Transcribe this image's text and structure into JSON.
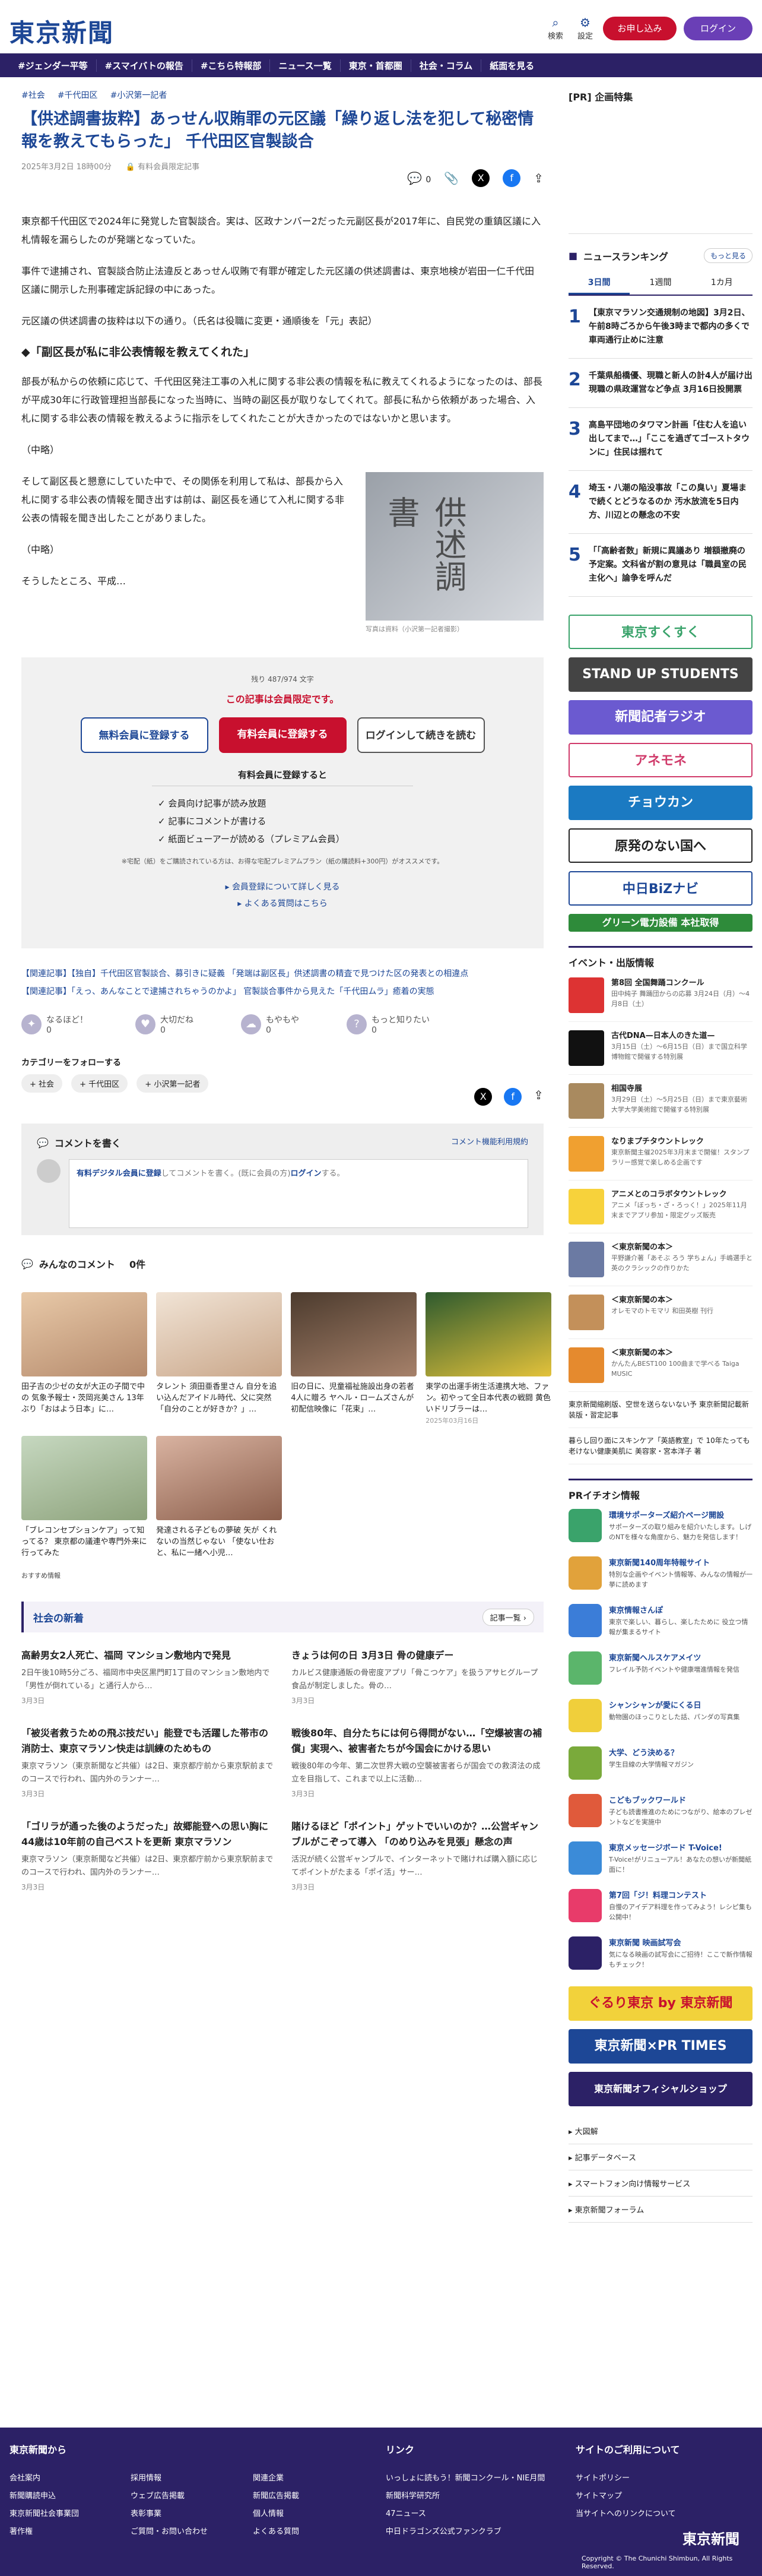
{
  "header": {
    "logo": "東京新聞",
    "search": "検索",
    "settings": "設定",
    "free": "お申し込み",
    "login": "ログイン"
  },
  "nav": [
    "#ジェンダー平等",
    "#スマイバトの報告",
    "#こちら特報部",
    "ニュース一覧",
    "東京・首都圏",
    "社会・コラム",
    "紙面を見る"
  ],
  "breadcrumb": [
    "#社会",
    "#千代田区",
    "#小沢第一記者"
  ],
  "article": {
    "title": "【供述調書抜粋】あっせん収賄罪の元区議「繰り返し法を犯して秘密情報を教えてもらった」 千代田区官製談合",
    "date": "2025年3月2日 18時00分",
    "member": "有料会員限定記事",
    "comments": "0",
    "p1": "東京都千代田区で2024年に発覚した官製談合。実は、区政ナンバー2だった元副区長が2017年に、自民党の重鎮区議に入札情報を漏らしたのが発端となっていた。",
    "p2": "事件で逮捕され、官製談合防止法違反とあっせん収賄で有罪が確定した元区議の供述調書は、東京地検が岩田一仁千代田区議に開示した刑事確定訴記録の中にあった。",
    "p3": "元区議の供述調書の抜粋は以下の通り。（氏名は役職に変更・通順後を「元」表記）",
    "h2": "◆「副区長が私に非公表情報を教えてくれた」",
    "p4": "部長が私からの依頼に応じて、千代田区発注工事の入札に関する非公表の情報を私に教えてくれるようになったのは、部長が平成30年に行政管理担当部長になった当時に、当時の副区長が取りなしてくれて。部長に私から依頼があった場合、入札に関する非公表の情報を教えるように指示をしてくれたことが大きかったのではないかと思います。",
    "p5": "（中略）",
    "p6": "そして副区長と懇意にしていた中で、その関係を利用して私は、部長から入札に関する非公表の情報を聞き出すは前は、副区長を通じて入札に関する非公表の情報を聞き出したことがありました。",
    "p7": "（中略）",
    "p8": "そうしたところ、平成…",
    "img_title": "供述調書",
    "caption": "写真は資料（小沢第一記者撮影）"
  },
  "paywall": {
    "count": "残り 487/974 文字",
    "msg": "この記事は会員限定です。",
    "free_btn": "無料会員に登録する",
    "paid_btn": "有料会員に登録する",
    "login_btn": "ログインして続きを読む",
    "benefit_title": "有料会員に登録すると",
    "benefits": [
      "会員向け記事が読み放題",
      "記事にコメントが書ける",
      "紙面ビューアーが読める（プレミアム会員）"
    ],
    "note": "※宅配（紙）をご購読されている方は、お得な宅配プレミアムプラン（紙の購読料+300円）がオススメです。",
    "link1": "会員登録について詳しく見る",
    "link2": "よくある質問はこちら"
  },
  "related": [
    "【関連記事】【独自】千代田区官製談合、募引きに疑義 「発端は副区長」供述調書の精査で見つけた区の発表との相違点",
    "【関連記事】「えっ、あんなことで逮捕されちゃうのかよ」 官製談合事件から見えた「千代田ムラ」癒着の実態"
  ],
  "reactions": [
    "なるほど！",
    "大切だね",
    "もやもや",
    "もっと知りたい"
  ],
  "reaction_counts": [
    "0",
    "0",
    "0",
    "0"
  ],
  "follow": {
    "title": "カテゴリーをフォローする",
    "tags": [
      "社会",
      "千代田区",
      "小沢第一記者"
    ]
  },
  "comment": {
    "title": "コメントを書く",
    "policy": "コメント機能利用規約",
    "placeholder_link": "有料デジタル会員に登録",
    "placeholder_text": "してコメントを書く。(既に会員の方)",
    "login": "ログイン",
    "tail": "する。"
  },
  "allcomments": {
    "title": "みんなのコメント",
    "count": "0件"
  },
  "thumbs": [
    {
      "t": "田子吉の少ゼの女が大正の子間で中の 気象予報士・茨岡兆美さん 13年ぶり「おはよう日本」に…"
    },
    {
      "t": "タレント 須田亜香里さん 自分を追い込んだアイドル時代、父に突然「自分のことが好きか？」…"
    },
    {
      "t": "旧の日に、児童福祉施設出身の若者4人に贈ろ ヤヘル・ロームズさんが初配信映像に「花束」…"
    },
    {
      "t": "東学の出運手術生活連携大地、ファン。初やって全日本代表の戦闘 黄色いドリブラーは…"
    },
    {
      "t": "「ブレコンセプションケア」って知ってる？ 東京都の議連や専門外来に行ってみた"
    },
    {
      "t": "発達される子どもの夢破 矢が くれないの当然じゃない 「使ない仕おと、私に一緒へ小児…"
    }
  ],
  "thumb_date": "2025年03月16日",
  "recommend": "おすすめ情報",
  "society": {
    "title": "社会の新着",
    "more": "記事一覧",
    "items": [
      {
        "t": "高齢男女2人死亡、福岡 マンション敷地内で発見",
        "d": "2日午後10時5分ごろ、福岡市中央区黒門町1丁目のマンション敷地内で「男性が倒れている」と通行人から…",
        "dt": "3月3日"
      },
      {
        "t": "きょうは何の日 3月3日 骨の健康デー",
        "d": "カルビス健康通販の骨密度アプリ「骨こつケア」を扱うアサヒグループ食品が制定しました。骨の…",
        "dt": "3月3日"
      },
      {
        "t": "「被災者救うための飛ぶ技だい」能登でも活躍した帯市の消防士、東京マラソン快走は訓練のためもの",
        "d": "東京マラソン（東京新聞など共催）は2日、東京都庁前から東京駅前までのコースで行われ、国内外のランナー…",
        "dt": "3月3日"
      },
      {
        "t": "戦後80年、自分たちには何ら得問がない…「空爆被害の補償」実現へ、被害者たちが今国会にかける思い",
        "d": "戦後80年の今年、第二次世界大戦の空襲被害者らが国会での救済法の成立を目指して、これまで以上に活動…",
        "dt": "3月3日"
      },
      {
        "t": "「ゴリラが通った後のようだった」故郷能登への思い胸に 44歳は10年前の自己ベストを更新 東京マラソン",
        "d": "東京マラソン（東京新聞など共催）は2日、東京都庁前から東京駅前までのコースで行われ、国内外のランナー…",
        "dt": "3月3日"
      },
      {
        "t": "賭けるほど「ポイント」ゲットでいいのか？…公営ギャンブルがこぞって導入 「のめり込みを見張」懸念の声",
        "d": "活況が続く公営ギャンブルで、インターネットで賭ければ購入額に応じてポイントがたまる「ポイ活」サー…",
        "dt": "3月3日"
      }
    ]
  },
  "sidebar": {
    "pr": "[PR] 企画特集",
    "ranking_title": "ニュースランキング",
    "ranking_more": "もっと見る",
    "tabs": [
      "3日間",
      "1週間",
      "1カ月"
    ],
    "ranking": [
      {
        "n": "1",
        "t": "【東京マラソン交通規制の地図】3月2日、午前8時ごろから午後3時まで都内の多くで車両通行止めに注意"
      },
      {
        "n": "2",
        "t": "千葉県船橋優、現職と新人の計4人が届け出 現職の県政運営など争点 3月16日投開票"
      },
      {
        "n": "3",
        "t": "高島平団地のタワマン計画「住む人を追い出してまで…」「ここを過ぎてゴーストタウンに」住民は揺れて"
      },
      {
        "n": "4",
        "t": "埼玉・八潮の陥没事故「この臭い」夏場まで続くとどうなるのか 汚水放流を5日内方、川辺との懸念の不安"
      },
      {
        "n": "5",
        "t": "「「高齢者数」新規に異議あり 増額撤廃の予定案。文科省が割の意見は「職員室の民主化へ」論争を呼んだ"
      }
    ],
    "banners": [
      {
        "t": "東京すくすく",
        "c": "#3aa36b"
      },
      {
        "t": "STAND UP STUDENTS",
        "c": "#444"
      },
      {
        "t": "新聞記者ラジオ",
        "c": "#6b5ad0"
      },
      {
        "t": "アネモネ",
        "c": "#d03a6a"
      },
      {
        "t": "チョウカン",
        "c": "#1b7ac2"
      },
      {
        "t": "原発のない国へ",
        "c": "#222"
      },
      {
        "t": "中日BiZナビ",
        "c": "#1d4796"
      },
      {
        "t": "グリーン電力設備 本社取得",
        "c": "#2e8b3a"
      }
    ],
    "event_title": "イベント・出版情報",
    "events": [
      {
        "t": "第8回 全国舞踊コンクール",
        "d": "田中純子 舞踊団からの応募 3月24日（月）〜4月8日（土）"
      },
      {
        "t": "古代DNA—日本人のきた道—",
        "d": "3月15日（土）〜6月15日（日）まで国立科学博物館で開催する特別展"
      },
      {
        "t": "相国寺展",
        "d": "3月29日（土）〜5月25日（日）まで東京藝術大学大学美術館で開催する特別展"
      },
      {
        "t": "なりまプチタウントレック",
        "d": "東京新聞主催2025年3月末まで開催！スタンプラリー感覚で楽しめる企画です"
      },
      {
        "t": "アニメとのコラボタウントレック",
        "d": "アニメ「ぼっち・ざ・ろっく！」2025年11月末までアプリ参加・限定グッズ販売"
      },
      {
        "t": "＜東京新聞の本＞",
        "d": "平野謙介著「あそぶ ろう 学ちょん」手嶋選手と英のクラシックの作りかた"
      },
      {
        "t": "＜東京新聞の本＞",
        "d": "オレモマのトモマリ 和田英樹 刊行"
      },
      {
        "t": "＜東京新聞の本＞",
        "d": "かんたんBEST100 100曲まで学べる Taiga MUSIC"
      }
    ],
    "side_links": [
      "東京新聞縮刷版、空世を送らないない予 東京新聞記載新装版・習定記事",
      "暮らし回り面にスキンケア「英語教室」で 10年たっても老けない健康美肌に 美容家・宮本洋子 著"
    ],
    "pr_title": "PRイチオシ情報",
    "pr_items": [
      {
        "t": "環境サポーターズ紹介ページ開設",
        "d": "サポーターズの取り組みを紹介いたします。しげのNTを様々な角度から、魅力を発信します！"
      },
      {
        "t": "東京新聞140周年特報サイト",
        "d": "特別な企画やイベント情報等、みんなの情報が一挙に読めます"
      },
      {
        "t": "東京情報さんぽ",
        "d": "東京で楽しい、暮らし、楽したために 役立つ情報が集まるサイト"
      },
      {
        "t": "東京新聞ヘルスケアメイツ",
        "d": "フレイル予防イベントや健康増進情報を発信"
      },
      {
        "t": "シャンシャンが愛にくる日",
        "d": "動物園のほっこりとした話、パンダの写真集"
      },
      {
        "t": "大学、どう決める？",
        "d": "学生目線の大学情報マガジン"
      },
      {
        "t": "こどもブックワールド",
        "d": "子ども読書推進のためにつながり、絵本のプレゼントなどを実施中"
      },
      {
        "t": "東京メッセージボード T-Voice!",
        "d": "T-Voice!がリニューアル！あなたの想いが新聞紙面に！"
      },
      {
        "t": "第7回「ジ！料理コンテスト",
        "d": "自慢のアイデア料理を作ってみよう！レシピ集も公開中！"
      },
      {
        "t": "東京新聞 映画試写会",
        "d": "気になる映画の試写会にご招待！ここで新作情報もチェック！"
      }
    ],
    "bottom_banners": [
      "ぐるり東京 by 東京新聞",
      "東京新聞×PR TIMES",
      "東京新聞オフィシャルショップ"
    ],
    "links": [
      "大図解",
      "記事データベース",
      "スマートフォン向け情報サービス",
      "東京新聞フォーラム"
    ]
  },
  "footer": {
    "col1": "東京新聞から",
    "col2": "リンク",
    "col3": "サイトのご利用について",
    "items1": [
      "会社案内",
      "採用情報",
      "関連企業",
      "新聞購読申込",
      "ウェブ広告掲載",
      "新聞広告掲載",
      "東京新聞社会事業団",
      "表彰事業",
      "個人情報",
      "著作権",
      "ご質問・お問い合わせ",
      "よくある質問"
    ],
    "items2": [
      "いっしょに読もう！新聞コンクール・NIE月間",
      "新聞科学研究所",
      "47ニュース",
      "中日ドラゴンズ公式ファンクラブ"
    ],
    "items3": [
      "サイトポリシー",
      "サイトマップ",
      "当サイトへのリンクについて"
    ],
    "copyright": "Copyright © The Chunichi Shimbun, All Rights Reserved.",
    "logo": "東京新聞"
  }
}
